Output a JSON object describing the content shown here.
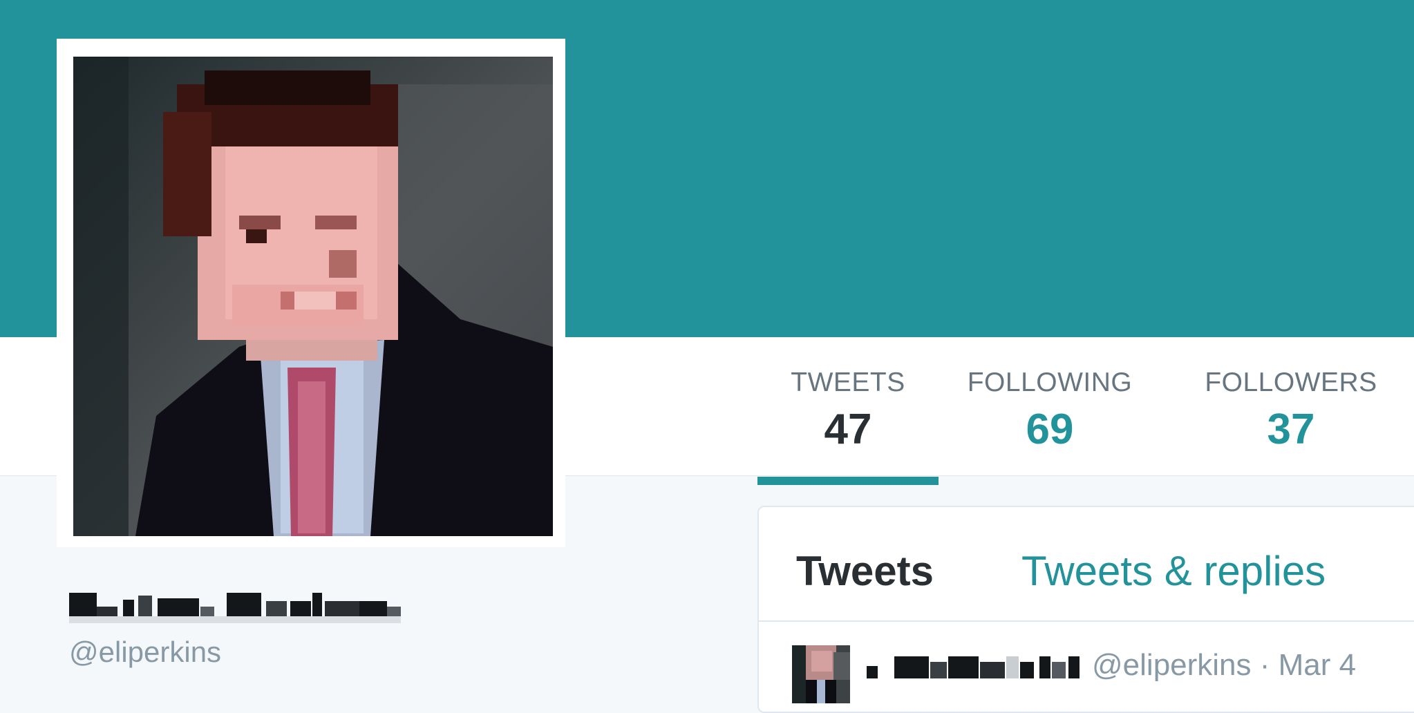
{
  "profile": {
    "handle": "@eliperkins"
  },
  "nav": {
    "stats": [
      {
        "label": "TWEETS",
        "value": "47"
      },
      {
        "label": "FOLLOWING",
        "value": "69"
      },
      {
        "label": "FOLLOWERS",
        "value": "37"
      }
    ]
  },
  "timeline": {
    "tabs": [
      {
        "label": "Tweets"
      },
      {
        "label": "Tweets & replies"
      }
    ],
    "tweet": {
      "handle": "@eliperkins",
      "separator": "·",
      "date": "Mar 4"
    }
  },
  "colors": {
    "accent": "#22939a",
    "banner": "#22939a",
    "text_dark": "#292f33",
    "text_muted": "#66757f",
    "page_bg": "#f5f8fa"
  }
}
